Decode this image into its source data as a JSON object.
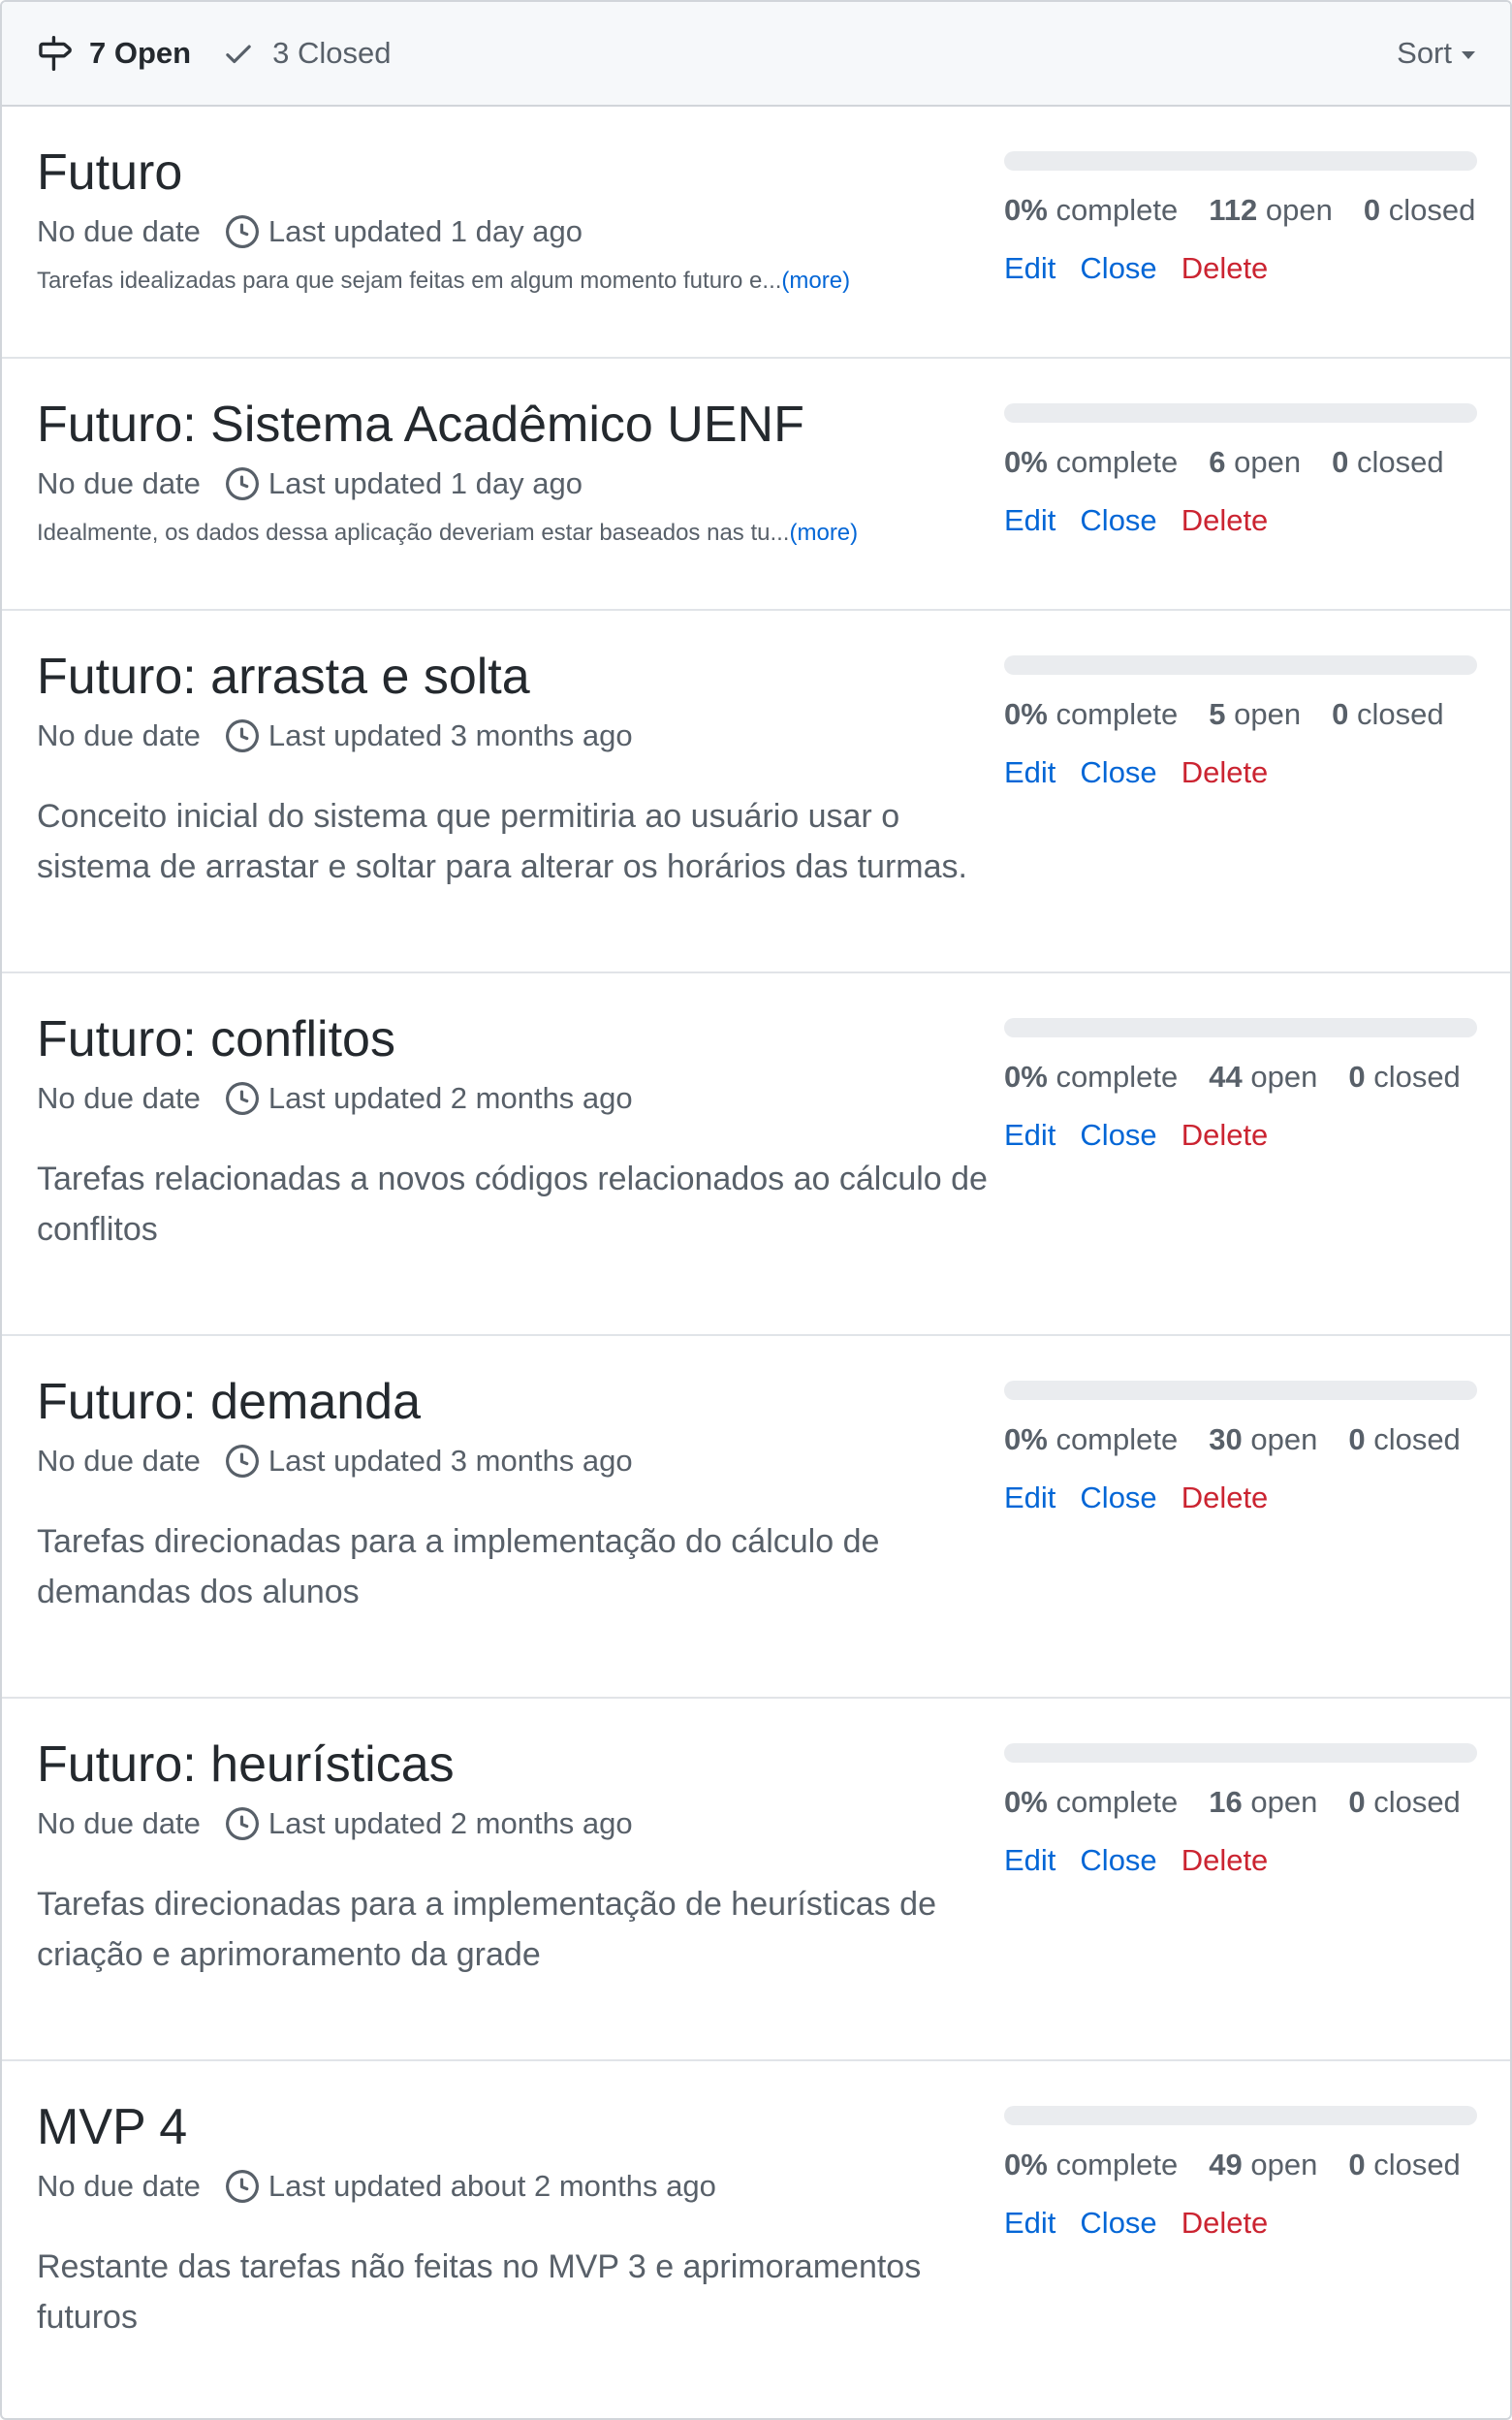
{
  "header": {
    "open_label": "7 Open",
    "closed_label": "3 Closed",
    "sort_label": "Sort"
  },
  "milestones": [
    {
      "title": "Futuro",
      "due": "No due date",
      "updated": "Last updated 1 day ago",
      "desc": "Tarefas idealizadas para que sejam feitas em algum momento futuro e...",
      "more": "(more)",
      "percent_text": "0%",
      "percent_label": "complete",
      "percent": 0,
      "open_count": "112",
      "open_label": "open",
      "closed_count": "0",
      "closed_label": "closed",
      "edit": "Edit",
      "close": "Close",
      "delete": "Delete"
    },
    {
      "title": "Futuro: Sistema Acadêmico UENF",
      "due": "No due date",
      "updated": "Last updated 1 day ago",
      "desc": "Idealmente, os dados dessa aplicação deveriam estar baseados nas tu...",
      "more": "(more)",
      "percent_text": "0%",
      "percent_label": "complete",
      "percent": 0,
      "open_count": "6",
      "open_label": "open",
      "closed_count": "0",
      "closed_label": "closed",
      "edit": "Edit",
      "close": "Close",
      "delete": "Delete"
    },
    {
      "title": "Futuro: arrasta e solta",
      "due": "No due date",
      "updated": "Last updated 3 months ago",
      "desc": "Conceito inicial do sistema que permitiria ao usuário usar o sistema de arrastar e soltar para alterar os horários das turmas.",
      "percent_text": "0%",
      "percent_label": "complete",
      "percent": 0,
      "open_count": "5",
      "open_label": "open",
      "closed_count": "0",
      "closed_label": "closed",
      "edit": "Edit",
      "close": "Close",
      "delete": "Delete"
    },
    {
      "title": "Futuro: conflitos",
      "due": "No due date",
      "updated": "Last updated 2 months ago",
      "desc": "Tarefas relacionadas a novos códigos relacionados ao cálculo de conflitos",
      "percent_text": "0%",
      "percent_label": "complete",
      "percent": 0,
      "open_count": "44",
      "open_label": "open",
      "closed_count": "0",
      "closed_label": "closed",
      "edit": "Edit",
      "close": "Close",
      "delete": "Delete"
    },
    {
      "title": "Futuro: demanda",
      "due": "No due date",
      "updated": "Last updated 3 months ago",
      "desc": "Tarefas direcionadas para a implementação do cálculo de demandas dos alunos",
      "percent_text": "0%",
      "percent_label": "complete",
      "percent": 0,
      "open_count": "30",
      "open_label": "open",
      "closed_count": "0",
      "closed_label": "closed",
      "edit": "Edit",
      "close": "Close",
      "delete": "Delete"
    },
    {
      "title": "Futuro: heurísticas",
      "due": "No due date",
      "updated": "Last updated 2 months ago",
      "desc": "Tarefas direcionadas para a implementação de heurísticas de criação e aprimoramento da grade",
      "percent_text": "0%",
      "percent_label": "complete",
      "percent": 0,
      "open_count": "16",
      "open_label": "open",
      "closed_count": "0",
      "closed_label": "closed",
      "edit": "Edit",
      "close": "Close",
      "delete": "Delete"
    },
    {
      "title": "MVP 4",
      "due": "No due date",
      "updated": "Last updated about 2 months ago",
      "desc": "Restante das tarefas não feitas no MVP 3 e aprimoramentos futuros",
      "percent_text": "0%",
      "percent_label": "complete",
      "percent": 0,
      "open_count": "49",
      "open_label": "open",
      "closed_count": "0",
      "closed_label": "closed",
      "edit": "Edit",
      "close": "Close",
      "delete": "Delete"
    }
  ]
}
